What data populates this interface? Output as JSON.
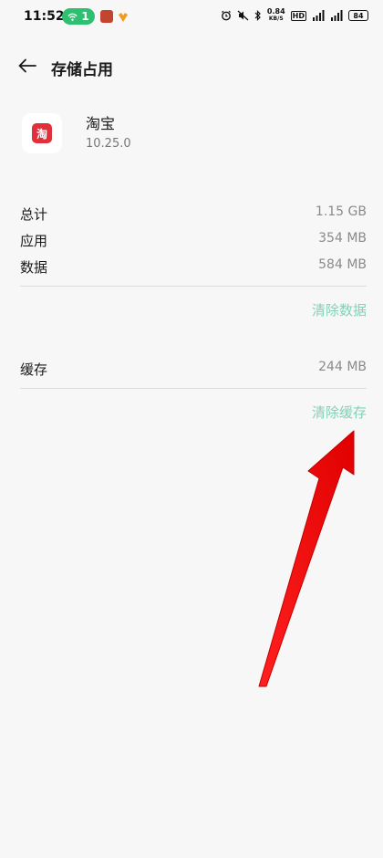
{
  "status_bar": {
    "time": "11:52",
    "hotspot_count": "1",
    "net_speed_value": "0.84",
    "net_speed_unit": "KB/S",
    "hd_label": "HD",
    "battery_level": "84"
  },
  "header": {
    "title": "存储占用"
  },
  "app": {
    "name": "淘宝",
    "version": "10.25.0",
    "icon_glyph": "淘",
    "brand_color": "#e0303b"
  },
  "storage": {
    "rows": [
      {
        "label": "总计",
        "value": "1.15 GB"
      },
      {
        "label": "应用",
        "value": "354 MB"
      },
      {
        "label": "数据",
        "value": "584 MB"
      }
    ],
    "clear_data_label": "清除数据"
  },
  "cache": {
    "label": "缓存",
    "value": "244 MB",
    "clear_cache_label": "清除缓存"
  },
  "colors": {
    "accent": "#7ed3b9",
    "annotation_arrow": "#ff0a0a",
    "hotspot": "#2fbf71"
  }
}
